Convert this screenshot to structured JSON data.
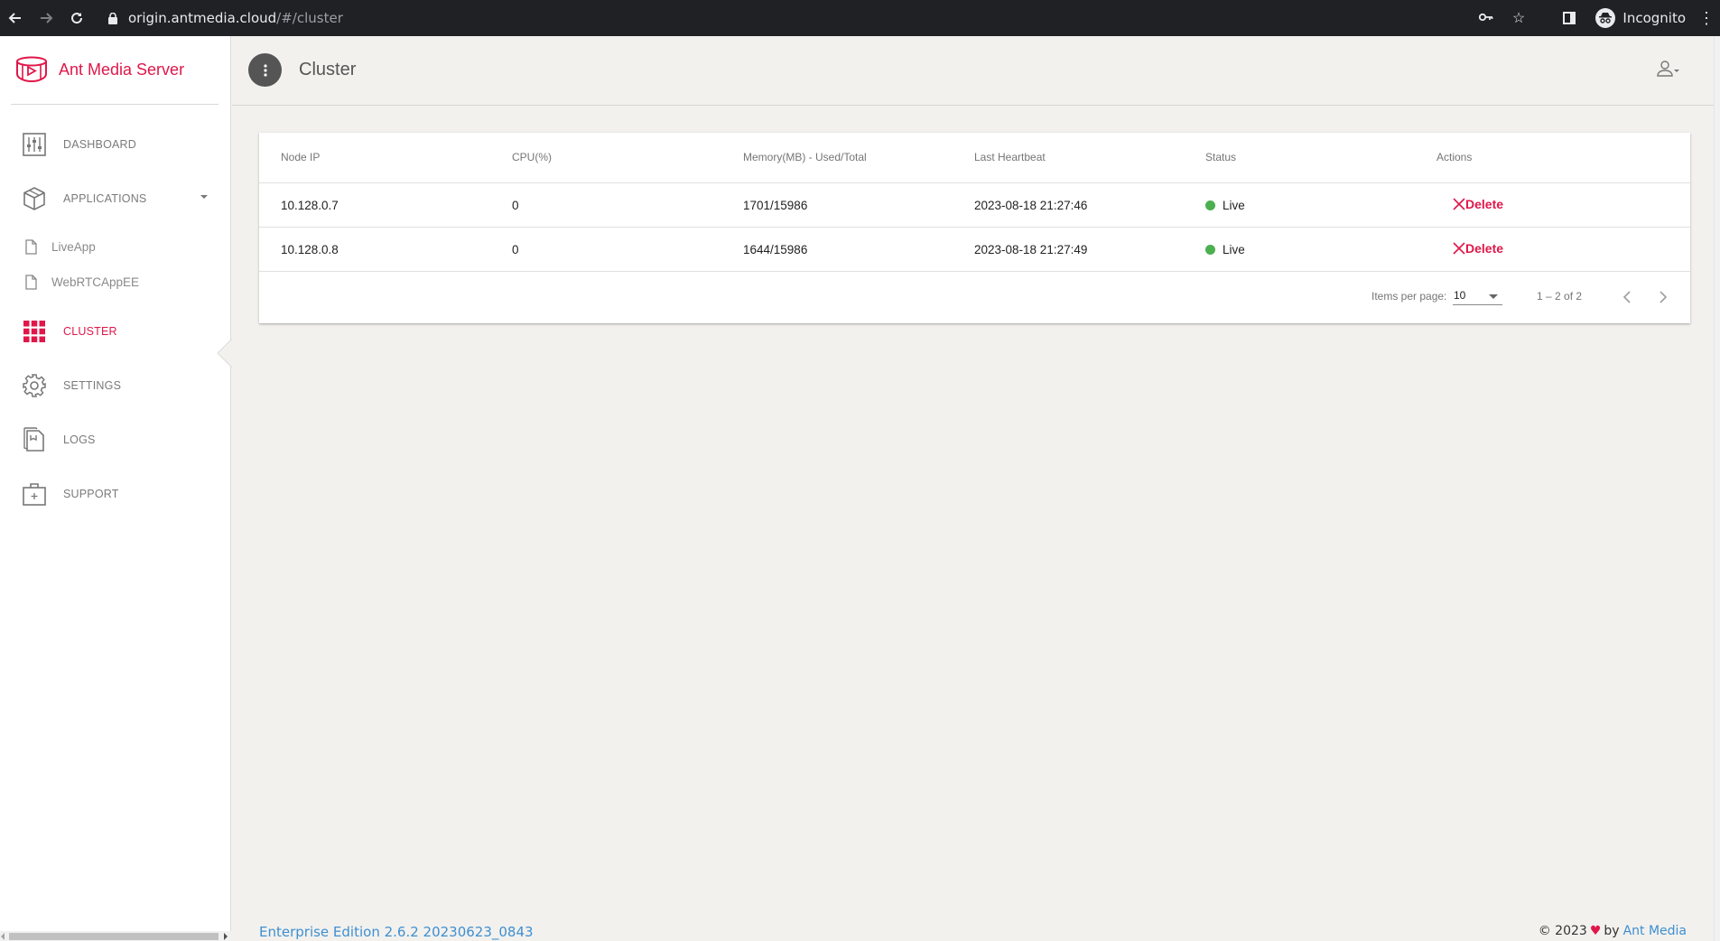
{
  "browser": {
    "url_host": "origin.antmedia.cloud",
    "url_path": "/#/cluster",
    "profile_label": "Incognito"
  },
  "brand": {
    "name": "Ant Media Server",
    "color": "#e0174a"
  },
  "sidebar": {
    "items": [
      {
        "label": "DASHBOARD",
        "icon": "dashboard-sliders-icon"
      },
      {
        "label": "APPLICATIONS",
        "icon": "cube-icon"
      },
      {
        "label": "CLUSTER",
        "icon": "grid-icon",
        "active": true
      },
      {
        "label": "SETTINGS",
        "icon": "gear-icon"
      },
      {
        "label": "LOGS",
        "icon": "logs-icon"
      },
      {
        "label": "SUPPORT",
        "icon": "support-kit-icon"
      }
    ],
    "apps": [
      {
        "label": "LiveApp",
        "icon": "file-icon"
      },
      {
        "label": "WebRTCAppEE",
        "icon": "file-icon"
      }
    ]
  },
  "header": {
    "title": "Cluster"
  },
  "table": {
    "columns": [
      "Node IP",
      "CPU(%)",
      "Memory(MB) - Used/Total",
      "Last Heartbeat",
      "Status",
      "Actions"
    ],
    "rows": [
      {
        "ip": "10.128.0.7",
        "cpu": "0",
        "memory": "1701/15986",
        "heartbeat": "2023-08-18 21:27:46",
        "status": "Live",
        "action": "Delete"
      },
      {
        "ip": "10.128.0.8",
        "cpu": "0",
        "memory": "1644/15986",
        "heartbeat": "2023-08-18 21:27:49",
        "status": "Live",
        "action": "Delete"
      }
    ],
    "status_color": "#4caf50"
  },
  "paginator": {
    "items_per_page_label": "Items per page:",
    "items_per_page_value": "10",
    "range_label": "1 – 2 of 2"
  },
  "footer": {
    "edition": "Enterprise Edition 2.6.2 20230623_0843",
    "copyright": "© 2023",
    "by": "by",
    "link": "Ant Media"
  }
}
